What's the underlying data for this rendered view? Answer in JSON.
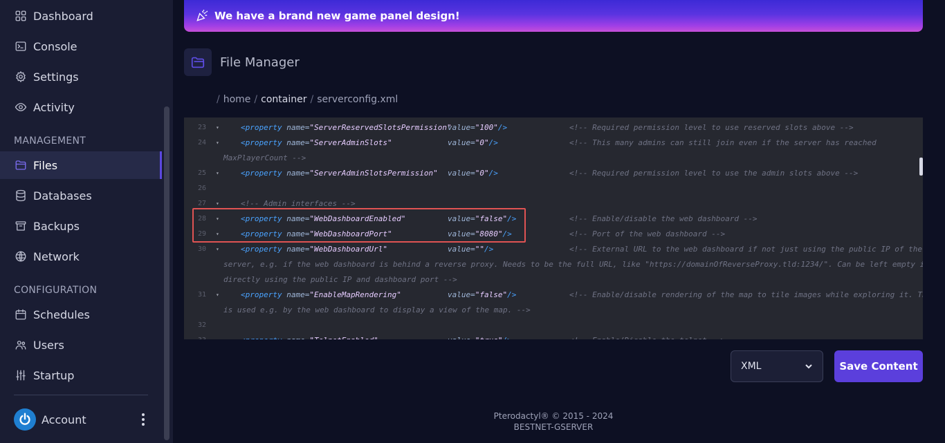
{
  "sidebar": {
    "items": [
      {
        "label": "Dashboard",
        "icon": "grid-icon"
      },
      {
        "label": "Console",
        "icon": "terminal-icon"
      },
      {
        "label": "Settings",
        "icon": "gear-icon"
      },
      {
        "label": "Activity",
        "icon": "eye-icon"
      },
      {
        "label": "Files",
        "icon": "folder-icon"
      },
      {
        "label": "Databases",
        "icon": "database-icon"
      },
      {
        "label": "Backups",
        "icon": "archive-icon"
      },
      {
        "label": "Network",
        "icon": "globe-icon"
      },
      {
        "label": "Schedules",
        "icon": "calendar-icon"
      },
      {
        "label": "Users",
        "icon": "users-icon"
      },
      {
        "label": "Startup",
        "icon": "sliders-icon"
      }
    ],
    "sections": {
      "management": "MANAGEMENT",
      "configuration": "CONFIGURATION"
    },
    "account_label": "Account",
    "active_item": "Files"
  },
  "banner": {
    "text": "We have a brand new game panel design!"
  },
  "header": {
    "title": "File Manager"
  },
  "breadcrumb": {
    "sep": "/",
    "home": "home",
    "container": "container",
    "file": "serverconfig.xml"
  },
  "editor": {
    "lines": [
      {
        "num": "23",
        "fold": "▾",
        "tag": "<property",
        "name_attr": " name=",
        "name_val": "\"ServerReservedSlotsPermission\"",
        "value_attr": "value=",
        "value_val": "\"100\"",
        "close": "/>",
        "comment": "<!-- Required permission level to use reserved slots above -->"
      },
      {
        "num": "24",
        "fold": "▾",
        "tag": "<property",
        "name_attr": " name=",
        "name_val": "\"ServerAdminSlots\"",
        "value_attr": "value=",
        "value_val": "\"0\"",
        "close": "/>",
        "comment": "<!-- This many admins can still join even if the server has reached"
      },
      {
        "cont": "MaxPlayerCount -->"
      },
      {
        "num": "25",
        "fold": "▾",
        "tag": "<property",
        "name_attr": " name=",
        "name_val": "\"ServerAdminSlotsPermission\"",
        "value_attr": "value=",
        "value_val": "\"0\"",
        "close": "/>",
        "comment": "<!-- Required permission level to use the admin slots above -->"
      },
      {
        "num": "26"
      },
      {
        "num": "27",
        "fold": "▾",
        "comment_inline": "<!-- Admin interfaces -->"
      },
      {
        "num": "28",
        "fold": "▾",
        "tag": "<property",
        "name_attr": " name=",
        "name_val": "\"WebDashboardEnabled\"",
        "value_attr": "value=",
        "value_val": "\"false\"",
        "close": "/>",
        "comment": "<!-- Enable/disable the web dashboard -->"
      },
      {
        "num": "29",
        "fold": "▾",
        "tag": "<property",
        "name_attr": " name=",
        "name_val": "\"WebDashboardPort\"",
        "value_attr": "value=",
        "value_val": "\"8080\"",
        "close": "/>",
        "comment": "<!-- Port of the web dashboard -->"
      },
      {
        "num": "30",
        "fold": "▾",
        "tag": "<property",
        "name_attr": " name=",
        "name_val": "\"WebDashboardUrl\"",
        "value_attr": "value=",
        "value_val": "\"\"",
        "close": "/>",
        "comment": "<!-- External URL to the web dashboard if not just using the public IP of the"
      },
      {
        "cont": "server, e.g. if the web dashboard is behind a reverse proxy. Needs to be the full URL, like \"https://domainOfReverseProxy.tld:1234/\". Can be left empty if"
      },
      {
        "cont": "directly using the public IP and dashboard port -->"
      },
      {
        "num": "31",
        "fold": "▾",
        "tag": "<property",
        "name_attr": " name=",
        "name_val": "\"EnableMapRendering\"",
        "value_attr": "value=",
        "value_val": "\"false\"",
        "close": "/>",
        "comment": "<!-- Enable/disable rendering of the map to tile images while exploring it. This"
      },
      {
        "cont": "is used e.g. by the web dashboard to display a view of the map. -->"
      },
      {
        "num": "32"
      },
      {
        "num": "33",
        "fold": "▾",
        "tag": "<property",
        "name_attr": " name=",
        "name_val": "\"TelnetEnabled\"",
        "value_attr": "value=",
        "value_val": "\"true\"",
        "close": "/>",
        "comment": "<!-- Enable/Disable the telnet -->"
      }
    ]
  },
  "controls": {
    "language": "XML",
    "save_label": "Save Content"
  },
  "footer": {
    "line1": "Pterodactyl® © 2015 - 2024",
    "line2": "BESTNET-GSERVER"
  },
  "colors": {
    "accent": "#5b3fdc",
    "highlight_box": "#e05353",
    "sidebar_bg": "#1a1d33",
    "page_bg": "#0d1023"
  }
}
